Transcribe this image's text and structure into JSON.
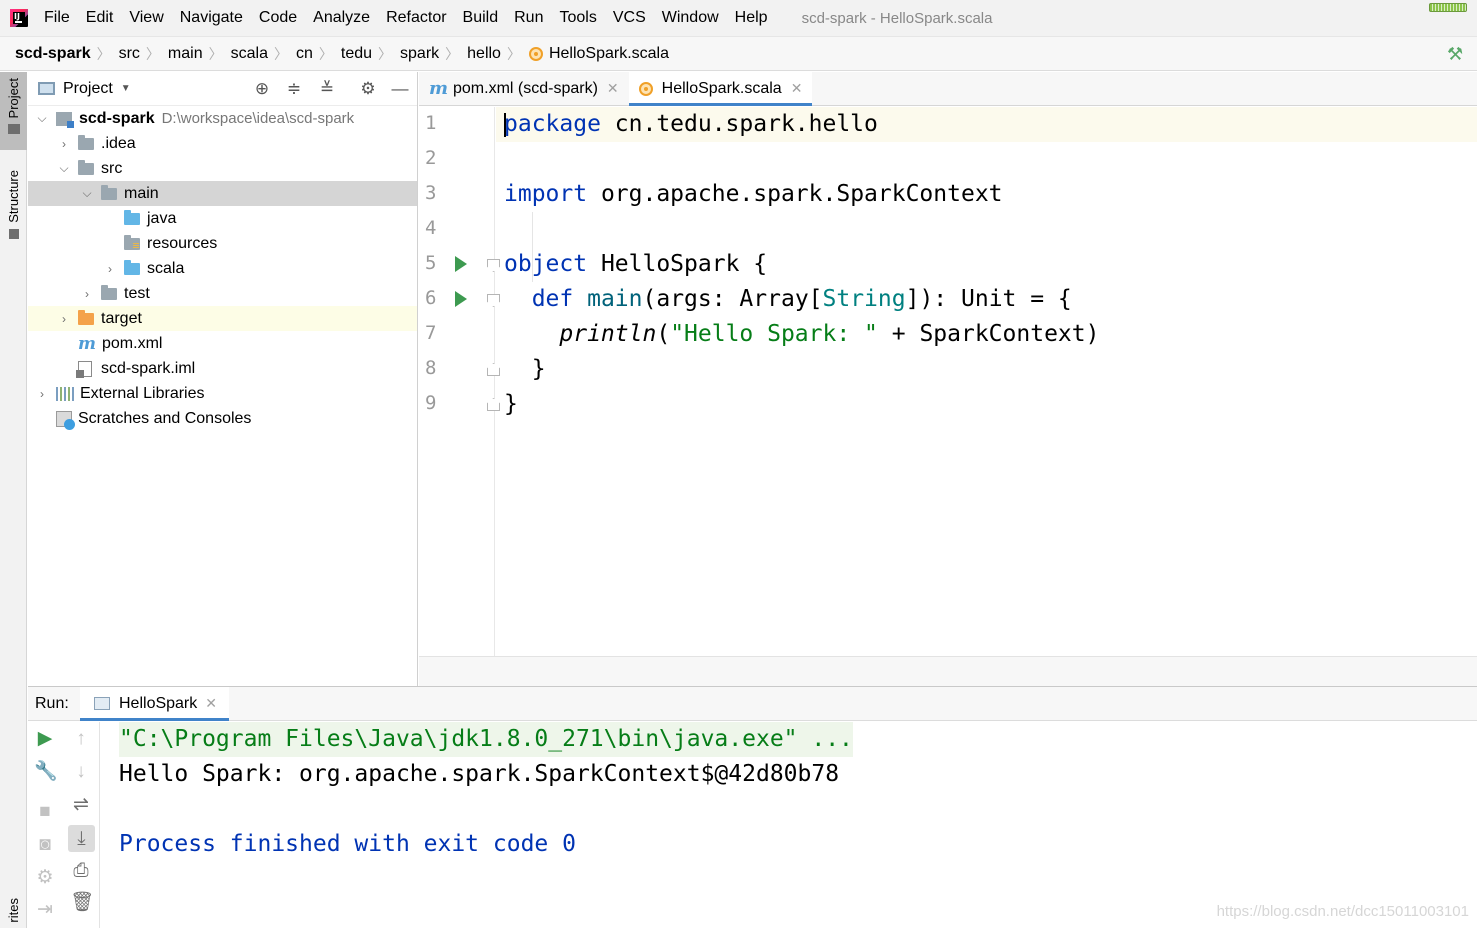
{
  "menubar": {
    "items": [
      "File",
      "Edit",
      "View",
      "Navigate",
      "Code",
      "Analyze",
      "Refactor",
      "Build",
      "Run",
      "Tools",
      "VCS",
      "Window",
      "Help"
    ],
    "window_title": "scd-spark - HelloSpark.scala"
  },
  "breadcrumb": [
    "scd-spark",
    "src",
    "main",
    "scala",
    "cn",
    "tedu",
    "spark",
    "hello",
    "HelloSpark.scala"
  ],
  "left_strip": {
    "project": "Project",
    "structure": "Structure",
    "favorites": "rites"
  },
  "project_panel": {
    "title": "Project",
    "tree": [
      {
        "label": "scd-spark",
        "path": "D:\\workspace\\idea\\scd-spark"
      },
      {
        "label": ".idea"
      },
      {
        "label": "src"
      },
      {
        "label": "main"
      },
      {
        "label": "java"
      },
      {
        "label": "resources"
      },
      {
        "label": "scala"
      },
      {
        "label": "test"
      },
      {
        "label": "target"
      },
      {
        "label": "pom.xml"
      },
      {
        "label": "scd-spark.iml"
      },
      {
        "label": "External Libraries"
      },
      {
        "label": "Scratches and Consoles"
      }
    ]
  },
  "editor": {
    "tabs": [
      {
        "label": "pom.xml (scd-spark)",
        "active": false
      },
      {
        "label": "HelloSpark.scala",
        "active": true
      }
    ],
    "line_numbers": [
      "1",
      "2",
      "3",
      "4",
      "5",
      "6",
      "7",
      "8",
      "9"
    ],
    "code": {
      "l1_kw": "package",
      "l1_rest": " cn.tedu.spark.hello",
      "l3_kw": "import",
      "l3_rest": " org.apache.spark.SparkContext",
      "l5_kw": "object",
      "l5_rest": " HelloSpark {",
      "l6_indent": "  ",
      "l6_kw": "def",
      "l6_sp": " ",
      "l6_fn": "main",
      "l6_a": "(args: Array[",
      "l6_type": "String",
      "l6_b": "]): Unit = {",
      "l7_indent": "    ",
      "l7_fn": "println",
      "l7_a": "(",
      "l7_str": "\"Hello Spark: \"",
      "l7_b": " + SparkContext)",
      "l8": "  }",
      "l9": "}"
    }
  },
  "run_panel": {
    "label": "Run:",
    "tab": "HelloSpark",
    "console": [
      "\"C:\\Program Files\\Java\\jdk1.8.0_271\\bin\\java.exe\" ...",
      "Hello Spark: org.apache.spark.SparkContext$@42d80b78",
      "Process finished with exit code 0"
    ]
  },
  "watermark": "https://blog.csdn.net/dcc15011003101",
  "colors": {
    "keyword": "#0033b3",
    "string": "#067d17",
    "type": "#008080",
    "run_green": "#3d9a50",
    "accent": "#4083c9"
  }
}
